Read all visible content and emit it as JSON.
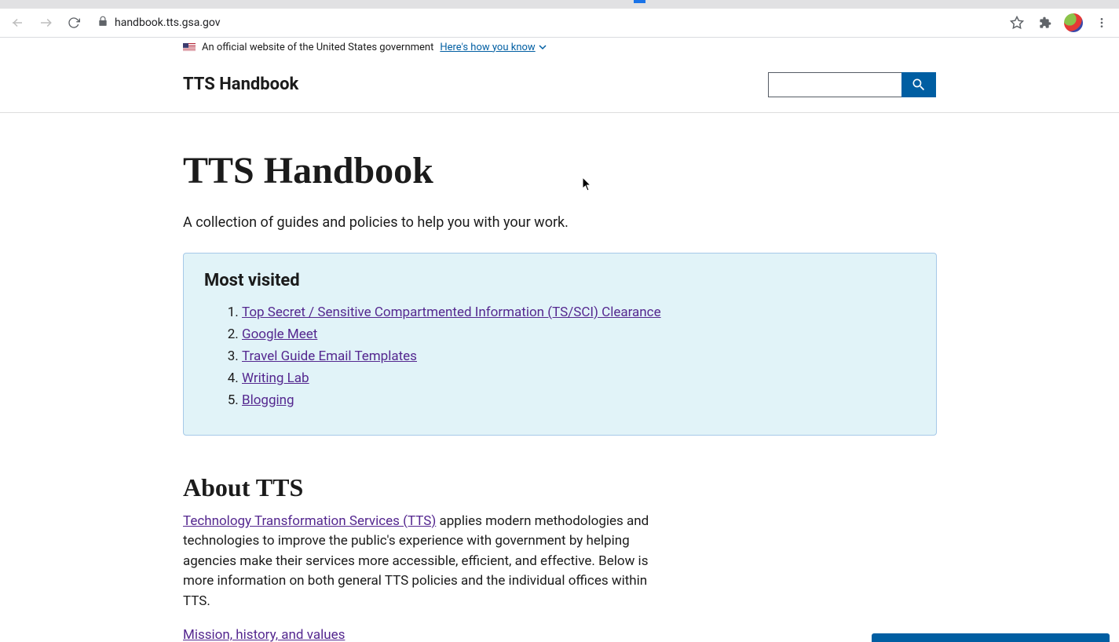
{
  "browser": {
    "url": "handbook.tts.gsa.gov"
  },
  "gov_banner": {
    "text": "An official website of the United States government",
    "link": "Here's how you know"
  },
  "header": {
    "site_title": "TTS Handbook"
  },
  "hero": {
    "title": "TTS Handbook",
    "lede": "A collection of guides and policies to help you with your work."
  },
  "most_visited": {
    "heading": "Most visited",
    "items": [
      "Top Secret / Sensitive Compartmented Information (TS/SCI) Clearance",
      "Google Meet",
      "Travel Guide Email Templates",
      "Writing Lab",
      "Blogging"
    ]
  },
  "about": {
    "heading": "About TTS",
    "link_text": "Technology Transformation Services (TTS)",
    "body_rest": " applies modern methodologies and technologies to improve the public's experience with government by helping agencies make their services more accessible, efficient, and effective. Below is more information on both general TTS policies and the individual offices within TTS.",
    "mission_link": "Mission, history, and values"
  }
}
